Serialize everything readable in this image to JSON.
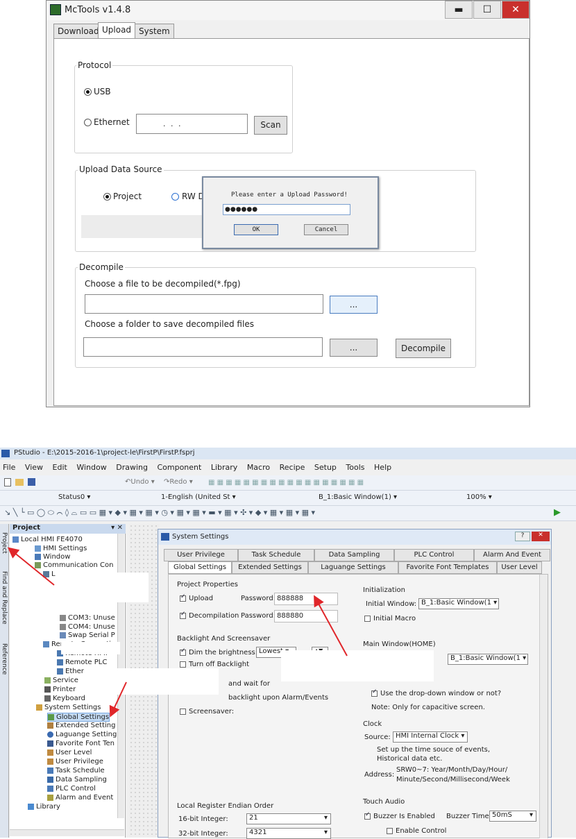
{
  "mctools": {
    "title": "McTools v1.4.8",
    "tabs": [
      "Download",
      "Upload",
      "System"
    ],
    "protocol": {
      "label": "Protocol",
      "usb": "USB",
      "ethernet": "Ethernet",
      "ip_value": ".   .   .",
      "scan": "Scan"
    },
    "upload_source": {
      "label": "Upload Data Source",
      "project": "Project",
      "rw": "RW D"
    },
    "password_dialog": {
      "message": "Please enter a Upload Password!",
      "value": "●●●●●●",
      "ok": "OK",
      "cancel": "Cancel"
    },
    "decompile": {
      "label": "Decompile",
      "file_prompt": "Choose a file to be decompiled(*.fpg)",
      "folder_prompt": "Choose a folder to save decompiled files",
      "browse": "...",
      "button": "Decompile"
    }
  },
  "pstudio": {
    "title": "PStudio - E:\\2015-2016-1\\project-le\\FirstP\\FirstP.fsprj",
    "menu": [
      "File",
      "View",
      "Edit",
      "Window",
      "Drawing",
      "Component",
      "Library",
      "Macro",
      "Recipe",
      "Setup",
      "Tools",
      "Help"
    ],
    "toolbar": {
      "undo": "Undo",
      "redo": "Redo",
      "status": "Status0",
      "language": "1-English (United St",
      "window": "B_1:Basic Window(1)",
      "zoom": "100%"
    },
    "side_tabs": [
      "Project",
      "Find and Replace",
      "Reference"
    ],
    "project_panel": {
      "title": "Project",
      "items": [
        "Local HMI FE4070",
        "HMI Settings",
        "Window",
        "Communication Con",
        "L",
        "COM3: Unuse",
        "COM4: Unuse",
        "Swap Serial P",
        "Remote Connecti",
        "Remote HMI",
        "Remote PLC",
        "Ether",
        "Service",
        "Printer",
        "Keyboard",
        "System Settings",
        "Global Settings",
        "Extended Setting",
        "Laguange Setting",
        "Favorite Font Ten",
        "User Level",
        "User Privilege",
        "Task Schedule",
        "Data Sampling",
        "PLC Control",
        "Alarm and Event",
        "Library"
      ]
    },
    "system_settings": {
      "title": "System Settings",
      "tabs_row1": [
        "User Privilege",
        "Task Schedule",
        "Data Sampling",
        "PLC Control",
        "Alarm And Event"
      ],
      "tabs_row2": [
        "Global Settings",
        "Extended Settings",
        "Laguange Settings",
        "Favorite Font Templates",
        "User Level"
      ],
      "project_properties": {
        "label": "Project Properties",
        "upload": "Upload",
        "decompilation": "Decompilation",
        "password_label": "Password:",
        "upload_password": "888888",
        "decompile_password": "888880"
      },
      "backlight": {
        "label": "Backlight And Screensaver",
        "dim": "Dim the brightness:",
        "dim_value": "Lowest",
        "turn_off": "Turn off Backlight",
        "wait": "and wait for",
        "upon_alarm": "backlight upon Alarm/Events",
        "screensaver": "Screensaver:"
      },
      "initialization": {
        "label": "Initialization",
        "initial_window": "Initial Window:",
        "initial_window_value": "B_1:Basic Window(1",
        "initial_macro": "Initial Macro"
      },
      "main_window": {
        "label": "Main Window(HOME)",
        "value": "B_1:Basic Window(1",
        "dropdown": "Use the drop-down window or not?",
        "note": "Note: Only for capacitive screen."
      },
      "clock": {
        "label": "Clock",
        "source": "Source:",
        "source_value": "HMI Internal Clock",
        "desc1": "Set up the time souce of events,",
        "desc2": "Historical data etc.",
        "address_label": "Address:",
        "address1": "SRW0~7: Year/Month/Day/Hour/",
        "address2": "Minute/Second/Millisecond/Week"
      },
      "endian": {
        "label": "Local Register Endian Order",
        "int16": "16-bit Integer:",
        "int16_value": "21",
        "int32": "32-bit Integer:",
        "int32_value": "4321"
      },
      "touch_audio": {
        "label": "Touch Audio",
        "buzzer": "Buzzer Is Enabled",
        "buzzer_time": "Buzzer Time:",
        "buzzer_time_value": "50mS",
        "enable_control": "Enable Control"
      }
    }
  },
  "colors": {
    "arrow": "#e0262a",
    "accent": "#2a5aa8",
    "close": "#c9302c"
  }
}
